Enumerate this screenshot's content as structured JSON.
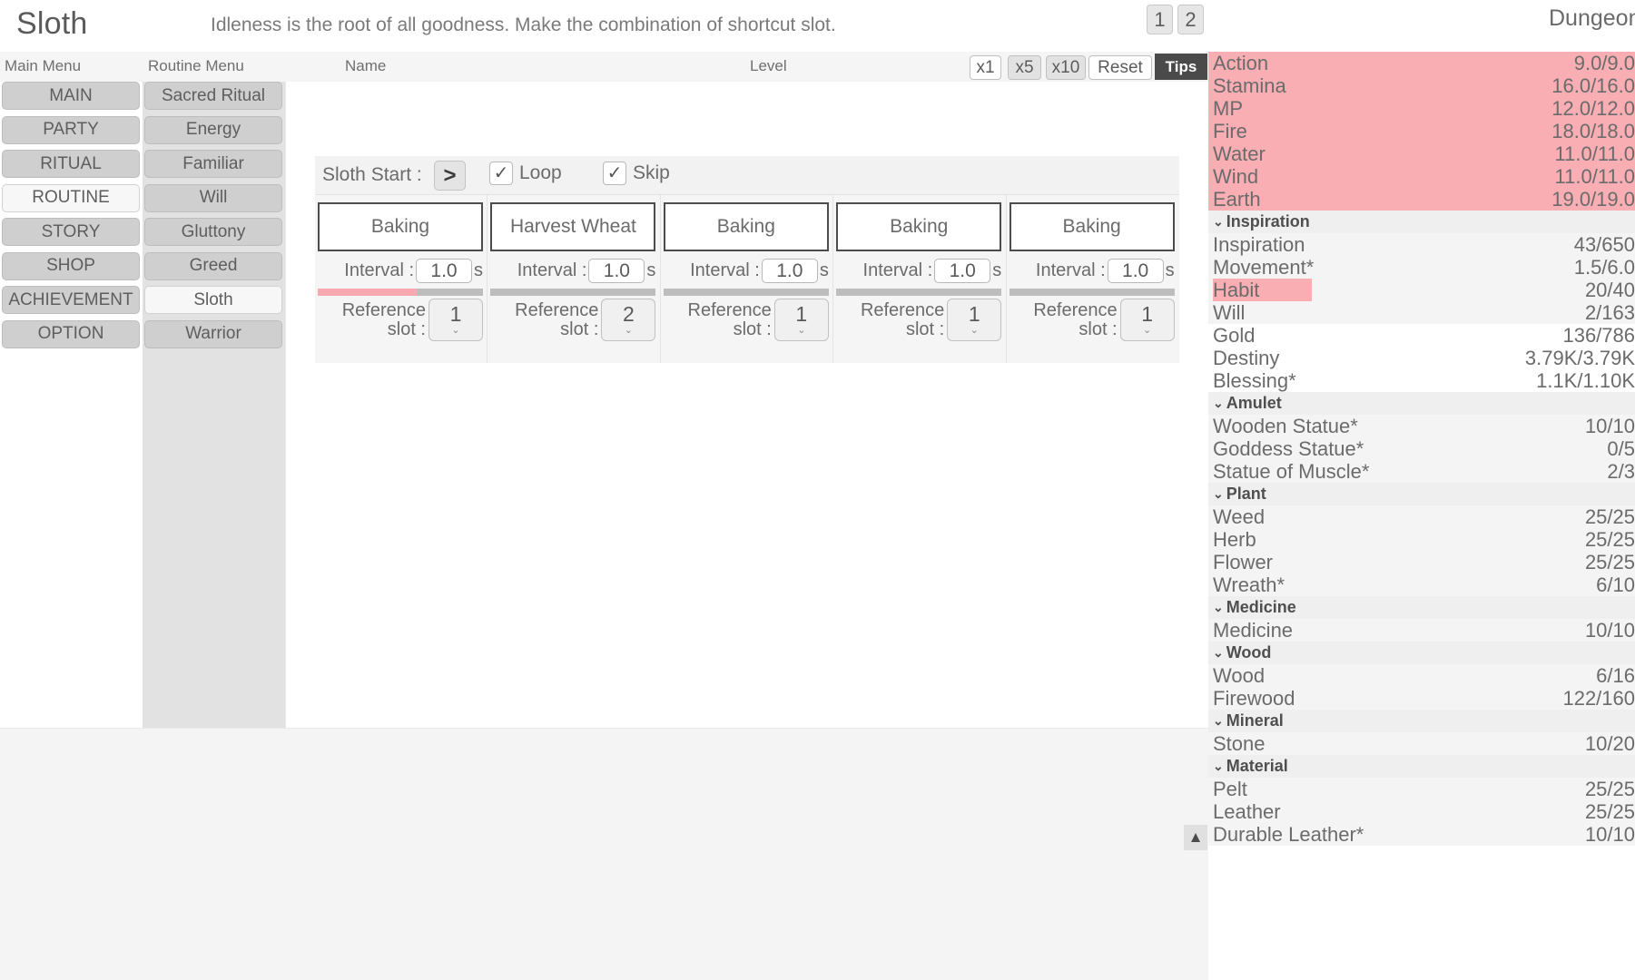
{
  "header": {
    "title": "Sloth",
    "subtitle": "Idleness is the root of all goodness. Make the combination of shortcut slot.",
    "page_buttons": [
      "1",
      "2"
    ],
    "dungeon_label": "Dungeon"
  },
  "column_headers": {
    "main_menu": "Main Menu",
    "routine_menu": "Routine Menu",
    "name": "Name",
    "level": "Level"
  },
  "multiplier_bar": {
    "x1": "x1",
    "x5": "x5",
    "x10": "x10",
    "reset": "Reset",
    "tips": "Tips"
  },
  "main_menu": {
    "items": [
      {
        "label": "MAIN",
        "selected": false
      },
      {
        "label": "PARTY",
        "selected": false
      },
      {
        "label": "RITUAL",
        "selected": false
      },
      {
        "label": "ROUTINE",
        "selected": true
      },
      {
        "label": "STORY",
        "selected": false
      },
      {
        "label": "SHOP",
        "selected": false
      },
      {
        "label": "ACHIEVEMENT",
        "selected": false
      },
      {
        "label": "OPTION",
        "selected": false
      }
    ]
  },
  "routine_menu": {
    "items": [
      {
        "label": "Sacred Ritual",
        "selected": false
      },
      {
        "label": "Energy",
        "selected": false
      },
      {
        "label": "Familiar",
        "selected": false
      },
      {
        "label": "Will",
        "selected": false
      },
      {
        "label": "Gluttony",
        "selected": false
      },
      {
        "label": "Greed",
        "selected": false
      },
      {
        "label": "Sloth",
        "selected": true
      },
      {
        "label": "Warrior",
        "selected": false
      }
    ]
  },
  "sloth_panel": {
    "start_label": "Sloth Start :",
    "start_button_glyph": ">",
    "loop_label": "Loop",
    "loop_checked": true,
    "skip_label": "Skip",
    "skip_checked": true,
    "check_glyph": "✓",
    "interval_label": "Interval :",
    "interval_unit": "s",
    "reference_label_line1": "Reference",
    "reference_label_line2": "slot :",
    "caret_glyph": "⌄",
    "slots": [
      {
        "name": "Baking",
        "interval": "1.0",
        "reference_slot": "1",
        "progress_pct": 60
      },
      {
        "name": "Harvest Wheat",
        "interval": "1.0",
        "reference_slot": "2",
        "progress_pct": 0
      },
      {
        "name": "Baking",
        "interval": "1.0",
        "reference_slot": "1",
        "progress_pct": 0
      },
      {
        "name": "Baking",
        "interval": "1.0",
        "reference_slot": "1",
        "progress_pct": 0
      },
      {
        "name": "Baking",
        "interval": "1.0",
        "reference_slot": "1",
        "progress_pct": 0
      }
    ]
  },
  "sidebar": {
    "scroll_up_glyph": "▲",
    "group_caret": "⌄",
    "rows": [
      {
        "type": "stat",
        "label": "Action",
        "value": "9.0/9.0",
        "style": "danger"
      },
      {
        "type": "stat",
        "label": "Stamina",
        "value": "16.0/16.0",
        "style": "danger"
      },
      {
        "type": "stat",
        "label": "MP",
        "value": "12.0/12.0",
        "style": "danger"
      },
      {
        "type": "stat",
        "label": "Fire",
        "value": "18.0/18.0",
        "style": "danger"
      },
      {
        "type": "stat",
        "label": "Water",
        "value": "11.0/11.0",
        "style": "danger"
      },
      {
        "type": "stat",
        "label": "Wind",
        "value": "11.0/11.0",
        "style": "danger"
      },
      {
        "type": "stat",
        "label": "Earth",
        "value": "19.0/19.0",
        "style": "danger"
      },
      {
        "type": "group",
        "label": "Inspiration"
      },
      {
        "type": "stat",
        "label": "Inspiration",
        "value": "43/650",
        "style": "alt"
      },
      {
        "type": "stat",
        "label": "Movement*",
        "value": "1.5/6.0",
        "style": "alt"
      },
      {
        "type": "stat",
        "label": "Habit",
        "value": "20/40",
        "style": "partial"
      },
      {
        "type": "stat",
        "label": "Will",
        "value": "2/163",
        "style": "alt"
      },
      {
        "type": "stat",
        "label": "Gold",
        "value": "136/786",
        "style": "plain"
      },
      {
        "type": "stat",
        "label": "Destiny",
        "value": "3.79K/3.79K",
        "style": "plain"
      },
      {
        "type": "stat",
        "label": "Blessing*",
        "value": "1.1K/1.10K",
        "style": "plain"
      },
      {
        "type": "group",
        "label": "Amulet"
      },
      {
        "type": "stat",
        "label": "Wooden Statue*",
        "value": "10/10",
        "style": "alt"
      },
      {
        "type": "stat",
        "label": "Goddess Statue*",
        "value": "0/5",
        "style": "alt"
      },
      {
        "type": "stat",
        "label": "Statue of Muscle*",
        "value": "2/3",
        "style": "alt"
      },
      {
        "type": "group",
        "label": "Plant"
      },
      {
        "type": "stat",
        "label": "Weed",
        "value": "25/25",
        "style": "alt"
      },
      {
        "type": "stat",
        "label": "Herb",
        "value": "25/25",
        "style": "alt"
      },
      {
        "type": "stat",
        "label": "Flower",
        "value": "25/25",
        "style": "alt"
      },
      {
        "type": "stat",
        "label": "Wreath*",
        "value": "6/10",
        "style": "alt"
      },
      {
        "type": "group",
        "label": "Medicine"
      },
      {
        "type": "stat",
        "label": "Medicine",
        "value": "10/10",
        "style": "alt"
      },
      {
        "type": "group",
        "label": "Wood"
      },
      {
        "type": "stat",
        "label": "Wood",
        "value": "6/16",
        "style": "alt"
      },
      {
        "type": "stat",
        "label": "Firewood",
        "value": "122/160",
        "style": "alt"
      },
      {
        "type": "group",
        "label": "Mineral"
      },
      {
        "type": "stat",
        "label": "Stone",
        "value": "10/20",
        "style": "alt"
      },
      {
        "type": "group",
        "label": "Material"
      },
      {
        "type": "stat",
        "label": "Pelt",
        "value": "25/25",
        "style": "alt"
      },
      {
        "type": "stat",
        "label": "Leather",
        "value": "25/25",
        "style": "alt"
      },
      {
        "type": "stat",
        "label": "Durable Leather*",
        "value": "10/10",
        "style": "alt"
      }
    ]
  }
}
